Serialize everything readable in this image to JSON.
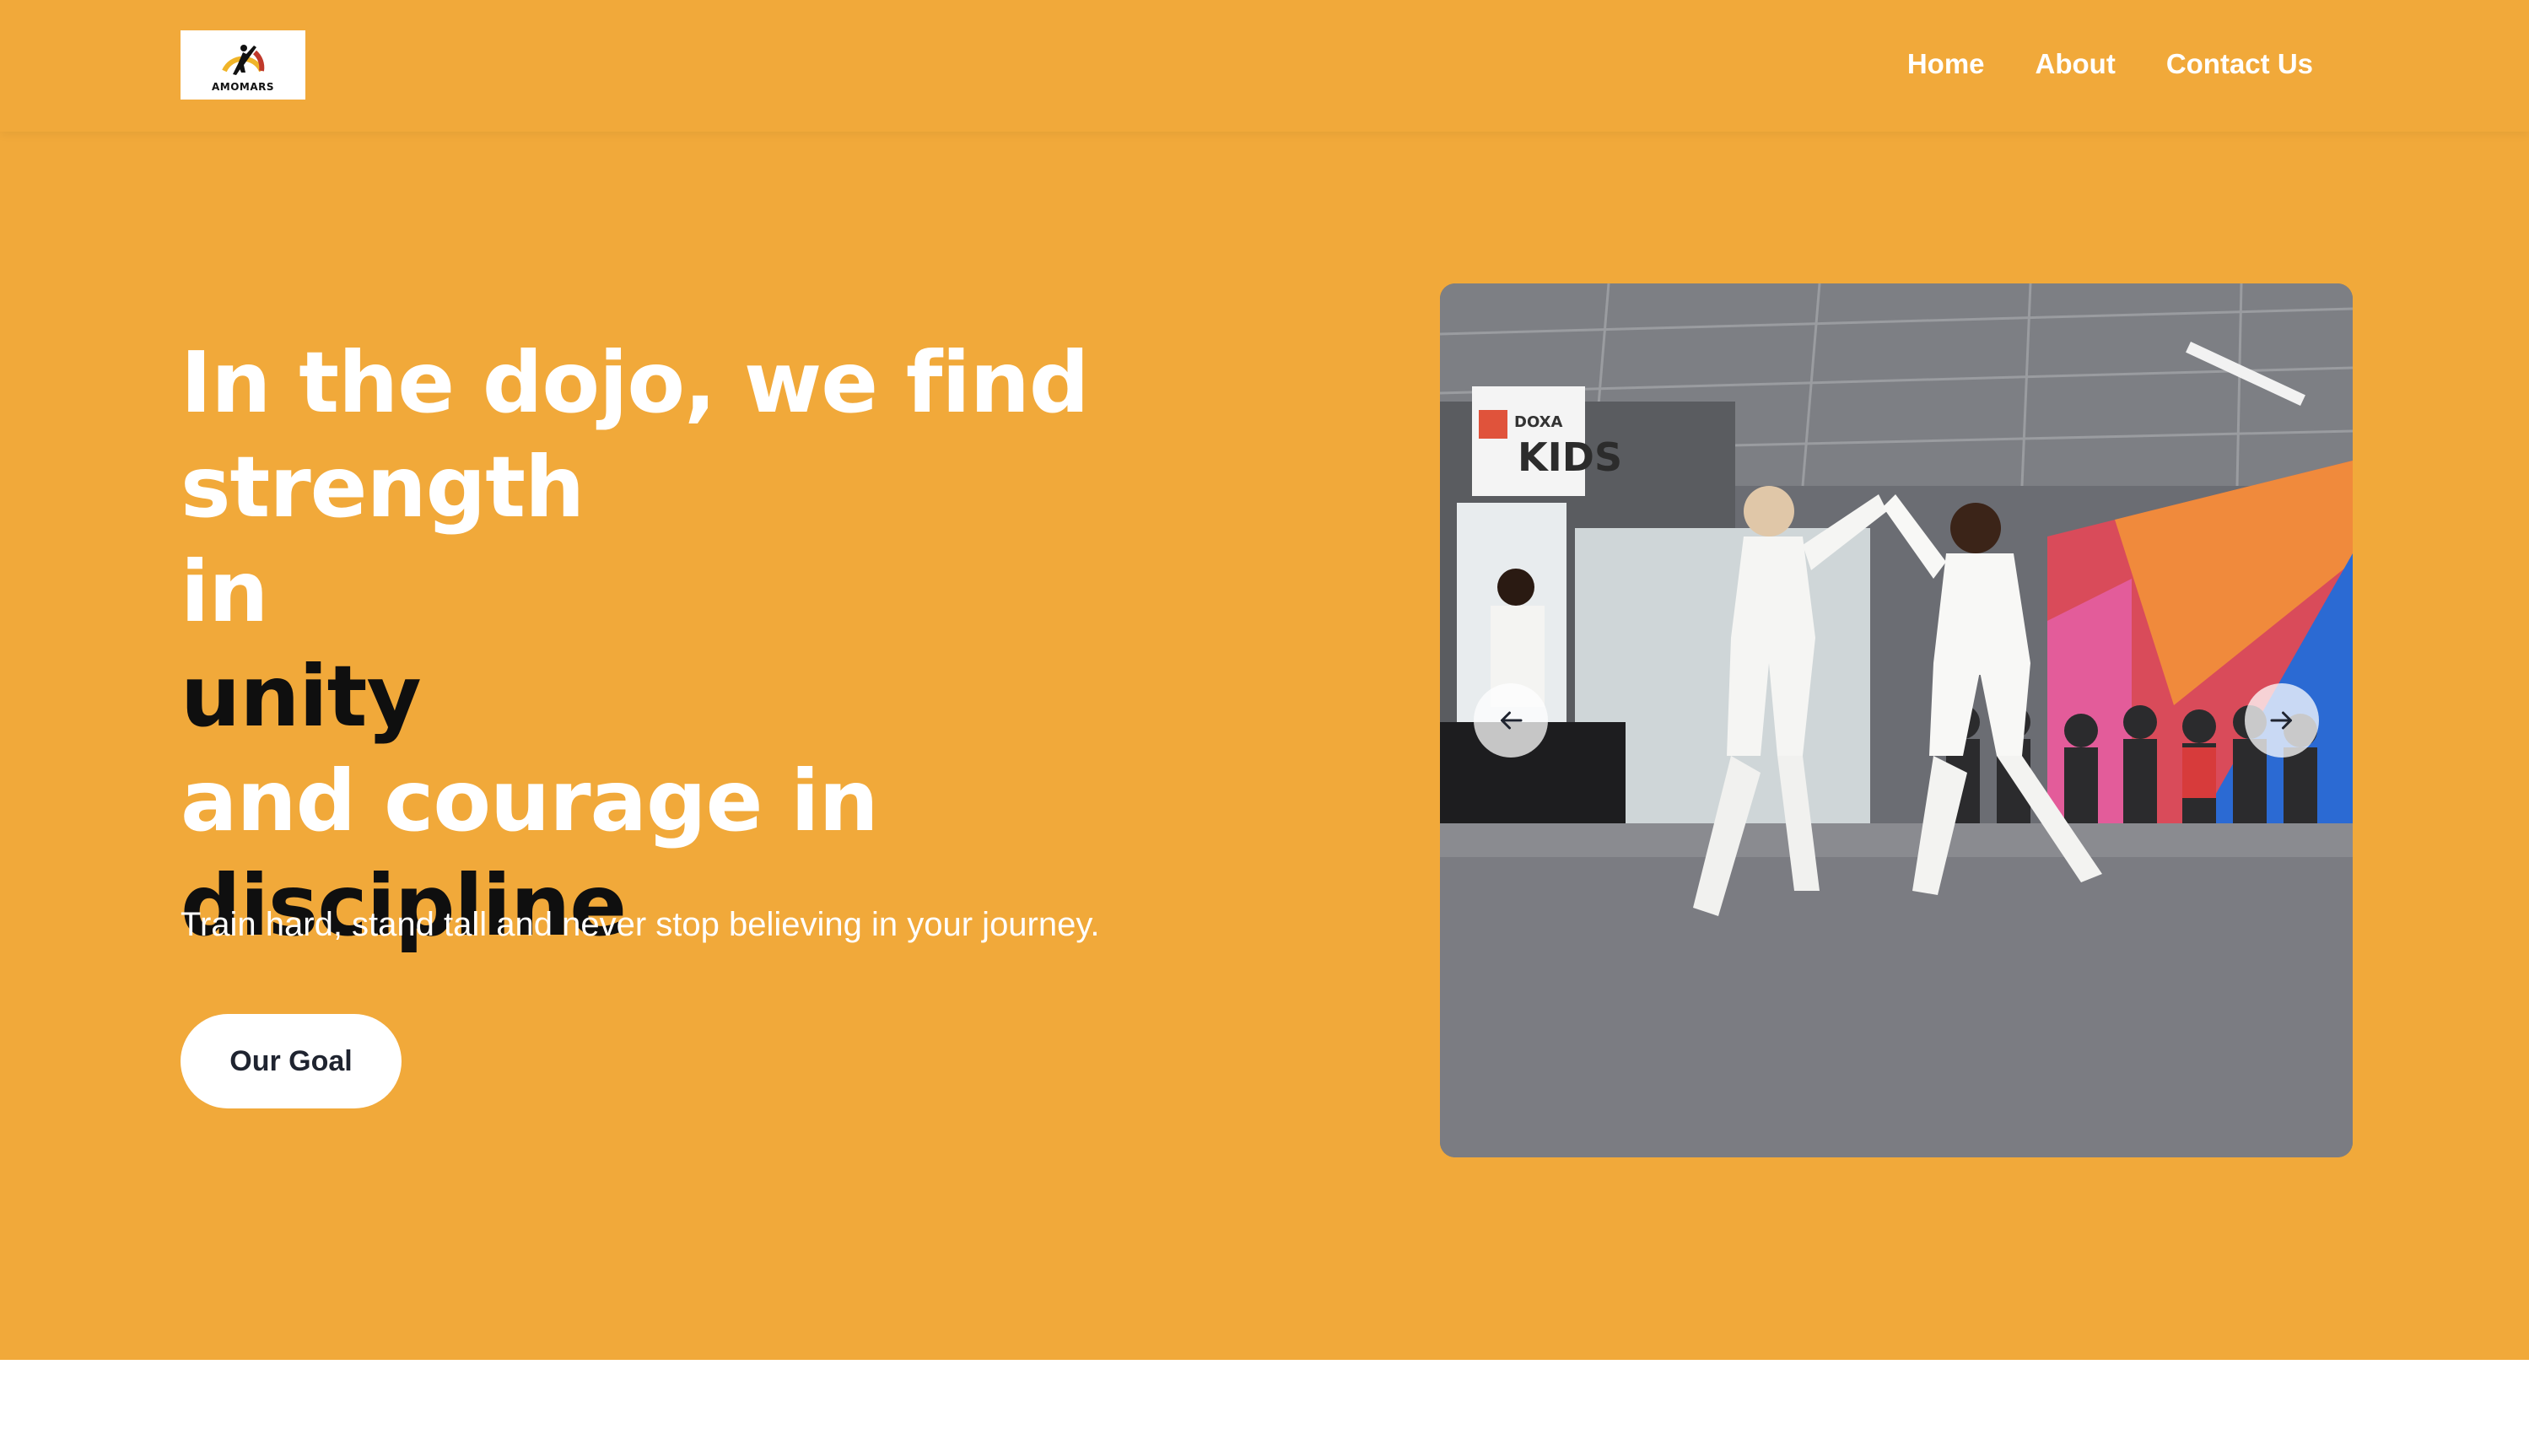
{
  "nav": {
    "logo_text": "AMOMARS",
    "links": [
      {
        "label": "Home"
      },
      {
        "label": "About"
      },
      {
        "label": "Contact Us"
      }
    ]
  },
  "hero": {
    "headline_line1": "In the dojo, we find strength",
    "headline_line2": "in",
    "headline_line3": "unity",
    "headline_line4": "and courage in",
    "headline_line5": "discipline",
    "subtitle": "Train hard, stand tall and never stop believing in your journey.",
    "cta_label": "Our Goal"
  },
  "carousel": {
    "sign_text_top": "DOXA",
    "sign_text_bottom": "KIDS"
  },
  "colors": {
    "hero_bg": "#f1a93a",
    "text_light": "#ffffff",
    "text_dark": "#0f0f0f",
    "button_text": "#1f2430"
  },
  "icons": {
    "prev": "arrow-left-icon",
    "next": "arrow-right-icon"
  }
}
